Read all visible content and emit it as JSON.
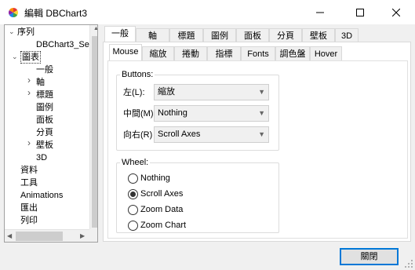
{
  "window": {
    "title": "編輯 DBChart3",
    "icon": "color-wheel-icon"
  },
  "tree": {
    "items": [
      {
        "label": "序列",
        "expander": "expanded"
      },
      {
        "label": "DBChart3_Se",
        "expander": ""
      },
      {
        "label": "圖表",
        "expander": "expanded"
      },
      {
        "label": "一般",
        "expander": ""
      },
      {
        "label": "軸",
        "expander": "collapsed"
      },
      {
        "label": "標題",
        "expander": "collapsed"
      },
      {
        "label": "圖例",
        "expander": ""
      },
      {
        "label": "面板",
        "expander": ""
      },
      {
        "label": "分頁",
        "expander": ""
      },
      {
        "label": "壁板",
        "expander": "collapsed"
      },
      {
        "label": "3D",
        "expander": ""
      },
      {
        "label": "資料",
        "expander": ""
      },
      {
        "label": "工具",
        "expander": ""
      },
      {
        "label": "Animations",
        "expander": ""
      },
      {
        "label": "匯出",
        "expander": ""
      },
      {
        "label": "列印",
        "expander": ""
      }
    ]
  },
  "main_tabs": {
    "items": [
      "一般",
      "軸",
      "標題",
      "圖例",
      "面板",
      "分頁",
      "壁板",
      "3D"
    ],
    "active": "一般"
  },
  "sub_tabs": {
    "items": [
      "Mouse",
      "縮放",
      "捲動",
      "指標",
      "Fonts",
      "調色盤",
      "Hover"
    ],
    "active": "Mouse"
  },
  "buttons_group": {
    "title": "Buttons:",
    "left_label": "左(L):",
    "left_value": "縮放",
    "middle_label": "中間(M)",
    "middle_value": "Nothing",
    "right_label": "向右(R)",
    "right_value": "Scroll Axes"
  },
  "wheel_group": {
    "title": "Wheel:",
    "options": [
      "Nothing",
      "Scroll Axes",
      "Zoom Data",
      "Zoom Chart"
    ],
    "selected": "Scroll Axes"
  },
  "footer": {
    "close_label": "關閉"
  }
}
